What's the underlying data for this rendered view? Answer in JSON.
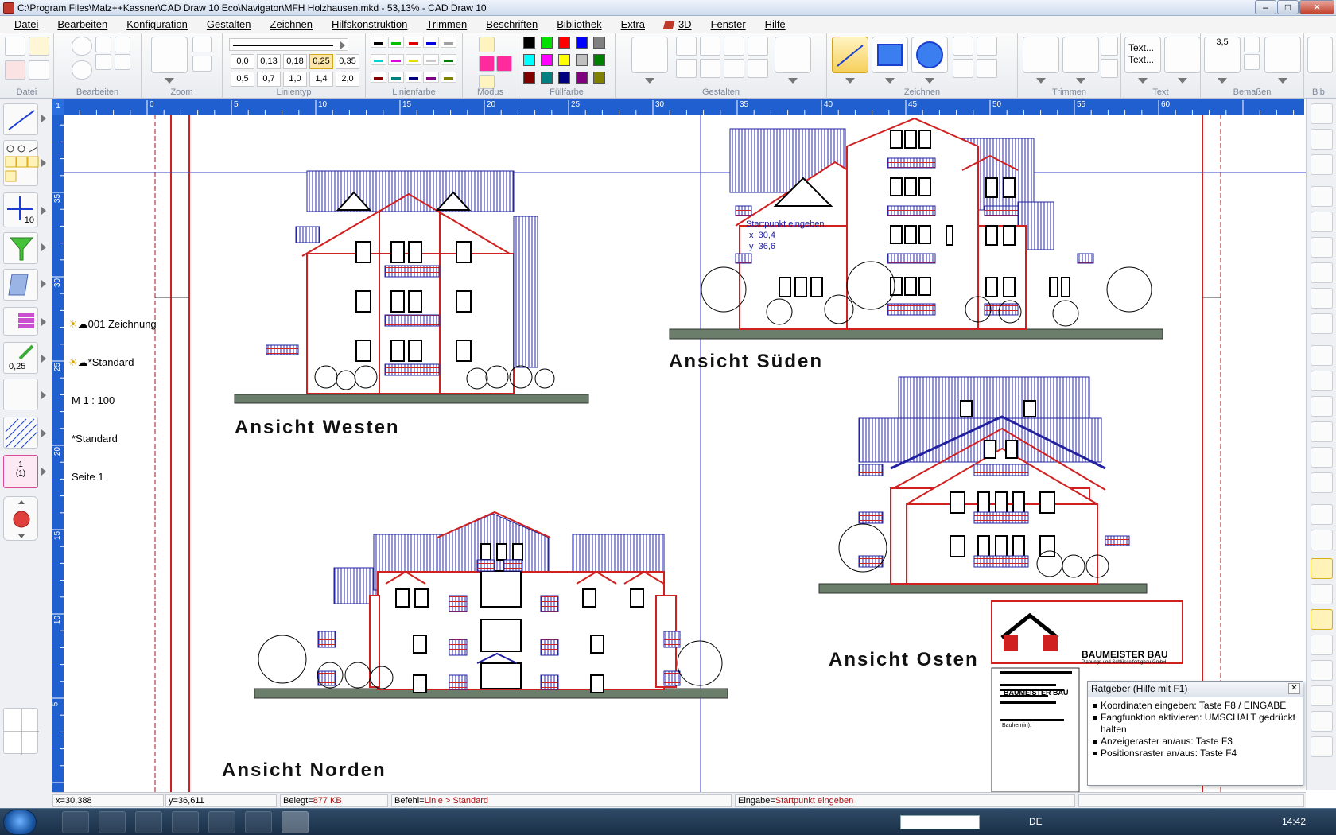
{
  "window": {
    "title": "C:\\Program Files\\Malz++Kassner\\CAD Draw 10 Eco\\Navigator\\MFH Holzhausen.mkd - 53,13% - CAD Draw 10"
  },
  "menu": [
    "Datei",
    "Bearbeiten",
    "Konfiguration",
    "Gestalten",
    "Zeichnen",
    "Hilfskonstruktion",
    "Trimmen",
    "Beschriften",
    "Bibliothek",
    "Extra",
    "3D",
    "Fenster",
    "Hilfe"
  ],
  "ribbon": {
    "groups": [
      "Datei",
      "Bearbeiten",
      "Zoom",
      "Linientyp",
      "Linienfarbe",
      "Modus",
      "Füllfarbe",
      "Gestalten",
      "Zeichnen",
      "Trimmen",
      "Text",
      "Bemaßen",
      "Bib"
    ],
    "linewidths_row1": [
      "0,0",
      "0,13",
      "0,18",
      "0,25",
      "0,35"
    ],
    "linewidths_row2": [
      "0,5",
      "0,7",
      "1,0",
      "1,4",
      "2,0"
    ],
    "selected_linewidth": "0,25",
    "text_button": {
      "line1": "Text...",
      "line2": "Text..."
    },
    "dimension_value": "3,5",
    "fill_colors": [
      "#000000",
      "#00e000",
      "#ff0000",
      "#0000ff",
      "#808080",
      "#00ffff",
      "#ff00ff",
      "#ffff00",
      "#c0c0c0",
      "#008000",
      "#800000",
      "#008080",
      "#000080",
      "#800080",
      "#808000"
    ],
    "line_colors": [
      "#000000",
      "#00c000",
      "#e00000",
      "#0000e0",
      "#a0a0a0",
      "#00d0d0",
      "#e000e0",
      "#e0e000",
      "#c8c8c8",
      "#008000",
      "#800000",
      "#008080",
      "#000080",
      "#800080",
      "#808000"
    ]
  },
  "ruler": {
    "corner": "1",
    "top_ticks": [
      "0",
      "5",
      "10",
      "15",
      "20",
      "25",
      "30",
      "35",
      "40",
      "45",
      "50",
      "55",
      "60"
    ],
    "left_ticks": [
      "35",
      "30",
      "25",
      "20",
      "15",
      "10",
      "5"
    ]
  },
  "left_panel": {
    "layer": "001 Zeichnung",
    "style": "*Standard",
    "scale": "M 1 : 100",
    "hatch": "*Standard",
    "page": "Seite 1",
    "linewidth": "0,25",
    "snap": "10",
    "page_btn": {
      "a": "1",
      "b": "(1)"
    }
  },
  "views": {
    "west": "Ansicht Westen",
    "sued": "Ansicht Süden",
    "nord": "Ansicht Norden",
    "ost": "Ansicht Osten"
  },
  "overlay": {
    "prompt": "Startpunkt eingeben",
    "x_label": "x",
    "x_val": "30,4",
    "y_label": "y",
    "y_val": "36,6"
  },
  "titleblock": {
    "company": "BAUMEISTER BAU",
    "subtitle": "Planungs und Schlüsselfertigbau GmbH",
    "logo_text": "BAUMEISTER BAU",
    "bauherr": "Bauherr(in):"
  },
  "ratgeber": {
    "title": "Ratgeber (Hilfe mit F1)",
    "tips": [
      "Koordinaten eingeben: Taste F8 / EINGABE",
      "Fangfunktion aktivieren: UMSCHALT gedrückt halten",
      "Anzeigeraster an/aus: Taste F3",
      "Positionsraster an/aus: Taste F4"
    ]
  },
  "status": {
    "x": "x=30,388",
    "y": "y=36,611",
    "belegt_label": "Belegt=",
    "belegt_val": "877 KB",
    "befehl_label": "Befehl=",
    "befehl_val": "Linie > Standard",
    "eingabe_label": "Eingabe=",
    "eingabe_val": "Startpunkt eingeben"
  },
  "taskbar": {
    "lang": "DE",
    "time": "14:42"
  }
}
